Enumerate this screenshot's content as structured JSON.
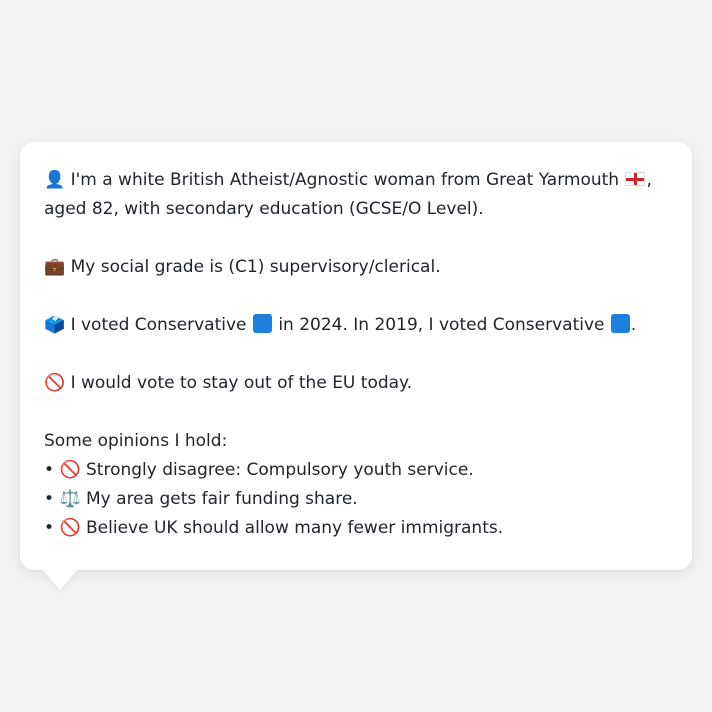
{
  "profile": {
    "intro": {
      "icon": "👤",
      "text_before_flag": " I'm a white British Atheist/Agnostic woman from Great Yarmouth ",
      "flag_icon": "england-flag-icon",
      "text_after_flag": ", aged 82, with secondary education (GCSE/O Level)."
    },
    "social": {
      "icon": "💼",
      "text": " My social grade is (C1) supervisory/clerical."
    },
    "vote": {
      "icon": "🗳️",
      "text_part1": " I voted Conservative ",
      "text_part2": " in 2024. In 2019, I voted Conservative ",
      "text_part3": ".",
      "party_color": "#1d7fe0"
    },
    "eu": {
      "icon": "🚫",
      "text": " I would vote to stay out of the EU today."
    },
    "opinions": {
      "heading": "Some opinions I hold:",
      "items": [
        {
          "bullet": "•",
          "icon": "🚫",
          "text": " Strongly disagree: Compulsory youth service."
        },
        {
          "bullet": "•",
          "icon": "⚖️",
          "text": " My area gets fair funding share."
        },
        {
          "bullet": "•",
          "icon": "🚫",
          "text": " Believe UK should allow many fewer immigrants."
        }
      ]
    }
  }
}
